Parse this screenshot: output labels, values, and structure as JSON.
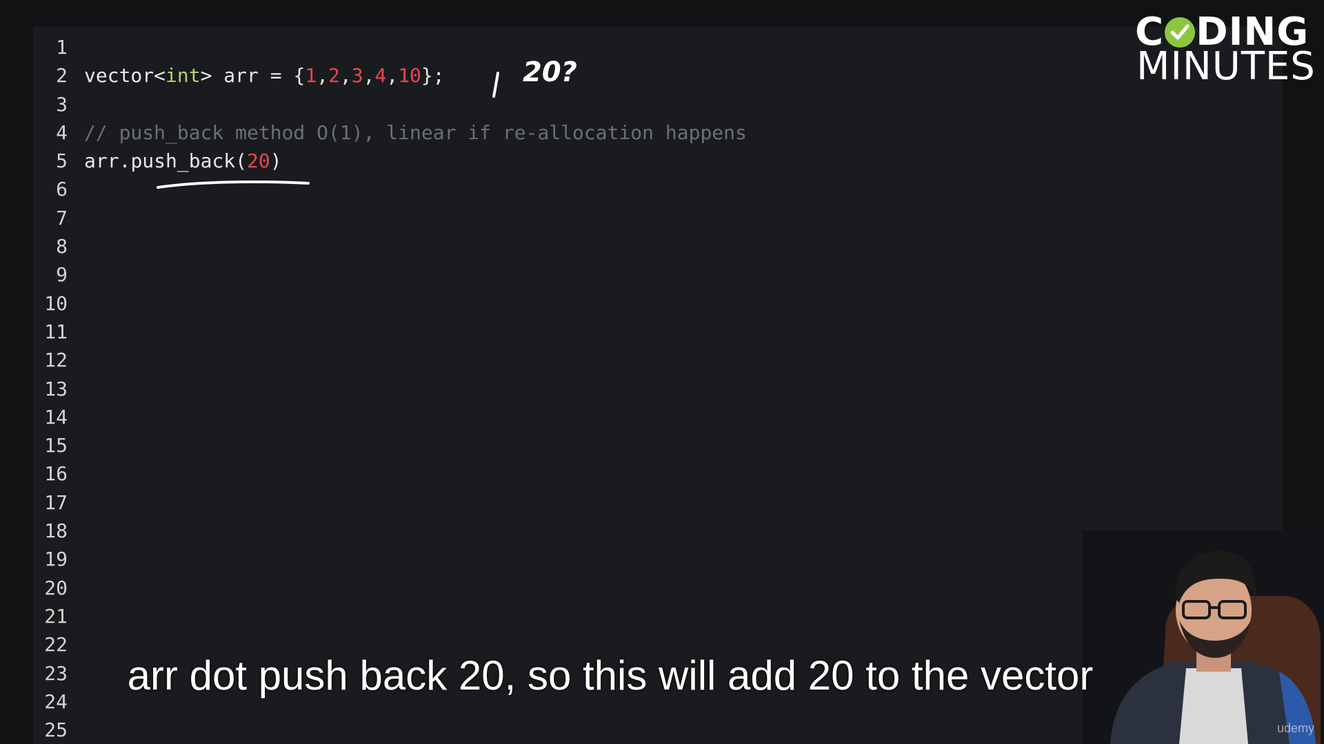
{
  "editor": {
    "line_numbers": [
      "1",
      "2",
      "3",
      "4",
      "5",
      "6",
      "7",
      "8",
      "9",
      "10",
      "11",
      "12",
      "13",
      "14",
      "15",
      "16",
      "17",
      "18",
      "19",
      "20",
      "21",
      "22",
      "23",
      "24",
      "25"
    ],
    "line2": {
      "kw": "vector",
      "lt": "<",
      "type": "int",
      "rest": "> arr = {",
      "n1": "1",
      "c1": ",",
      "n2": "2",
      "c2": ",",
      "n3": "3",
      "c3": ",",
      "n4": "4",
      "c4": ",",
      "n5": "10",
      "end": "};"
    },
    "line4_comment": "// push_back method O(1), linear if re-allocation happens",
    "line5": {
      "obj": "arr.",
      "method": "push_back",
      "open": "(",
      "arg": "20",
      "close": ")"
    }
  },
  "annotation": {
    "handwritten": "20?",
    "color": "#ffffff"
  },
  "logo": {
    "line1_a": "C",
    "line1_b": "DING",
    "line2": "MINUTES",
    "accent": "#8cc63f"
  },
  "subtitle": "arr dot push back 20, so this will add 20 to the vector",
  "watermark": "udemy",
  "colors": {
    "background": "#111214",
    "editor_bg": "#1a1b1e",
    "number": "#e8474f",
    "type": "#b5d36b",
    "comment": "#6b6f78"
  }
}
